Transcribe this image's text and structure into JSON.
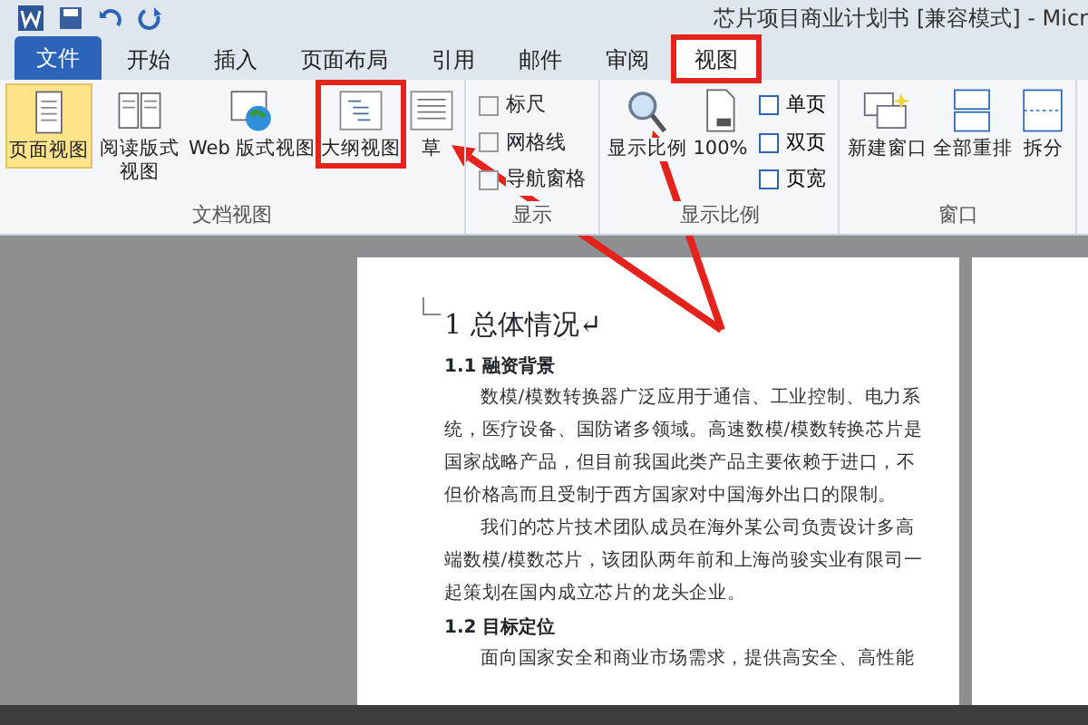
{
  "window": {
    "title": "芯片项目商业计划书 [兼容模式] - Micr"
  },
  "tabs": [
    {
      "label": "文件",
      "kind": "file",
      "selected": false,
      "highlighted": false
    },
    {
      "label": "开始",
      "kind": "tab",
      "selected": false,
      "highlighted": false
    },
    {
      "label": "插入",
      "kind": "tab",
      "selected": false,
      "highlighted": false
    },
    {
      "label": "页面布局",
      "kind": "tab",
      "selected": false,
      "highlighted": false
    },
    {
      "label": "引用",
      "kind": "tab",
      "selected": false,
      "highlighted": false
    },
    {
      "label": "邮件",
      "kind": "tab",
      "selected": false,
      "highlighted": false
    },
    {
      "label": "审阅",
      "kind": "tab",
      "selected": false,
      "highlighted": false
    },
    {
      "label": "视图",
      "kind": "tab",
      "selected": true,
      "highlighted": true
    }
  ],
  "ribbon_groups": [
    {
      "label": "文档视图",
      "items": [
        {
          "kind": "big",
          "label": "页面视图",
          "selected": true,
          "highlighted": false
        },
        {
          "kind": "big",
          "label": "阅读版式视图",
          "selected": false,
          "highlighted": false
        },
        {
          "kind": "big",
          "label": "Web 版式视图",
          "selected": false,
          "highlighted": false
        },
        {
          "kind": "big",
          "label": "大纲视图",
          "selected": false,
          "highlighted": true
        },
        {
          "kind": "big",
          "label": "草",
          "selected": false,
          "highlighted": false
        }
      ]
    },
    {
      "label": "显示",
      "items": [
        {
          "kind": "check",
          "label": "标尺",
          "checked": false
        },
        {
          "kind": "check",
          "label": "网格线",
          "checked": false
        },
        {
          "kind": "check",
          "label": "导航窗格",
          "checked": false
        }
      ]
    },
    {
      "label": "显示比例",
      "items": [
        {
          "kind": "big",
          "label": "显示比例",
          "selected": false,
          "highlighted": false
        },
        {
          "kind": "big",
          "label": "100%",
          "selected": false,
          "highlighted": false
        },
        {
          "kind": "small",
          "label": "单页"
        },
        {
          "kind": "small",
          "label": "双页"
        },
        {
          "kind": "small",
          "label": "页宽"
        }
      ]
    },
    {
      "label": "窗口",
      "items": [
        {
          "kind": "big",
          "label": "新建窗口",
          "selected": false,
          "highlighted": false
        },
        {
          "kind": "big",
          "label": "全部重排",
          "selected": false,
          "highlighted": false
        },
        {
          "kind": "big",
          "label": "拆分",
          "selected": false,
          "highlighted": false
        }
      ]
    }
  ],
  "document": {
    "paragraphs": [
      {
        "kind": "h1",
        "text": "1 总体情况↵"
      },
      {
        "kind": "h2",
        "text": "1.1 融资背景"
      },
      {
        "kind": "body",
        "text": "数模/模数转换器广泛应用于通信、工业控制、电力系统，医疗设备、国防诸多领域。高速数模/模数转换芯片是国家战略产品，但目前我国此类产品主要依赖于进口，不但价格高而且受制于西方国家对中国海外出口的限制。"
      },
      {
        "kind": "body",
        "text": "我们的芯片技术团队成员在海外某公司负责设计多高端数模/模数芯片，该团队两年前和上海尚骏实业有限司一起策划在国内成立芯片的龙头企业。"
      },
      {
        "kind": "h2",
        "text": "1.2 目标定位"
      },
      {
        "kind": "body",
        "text": "面向国家安全和商业市场需求，提供高安全、高性能"
      }
    ]
  }
}
